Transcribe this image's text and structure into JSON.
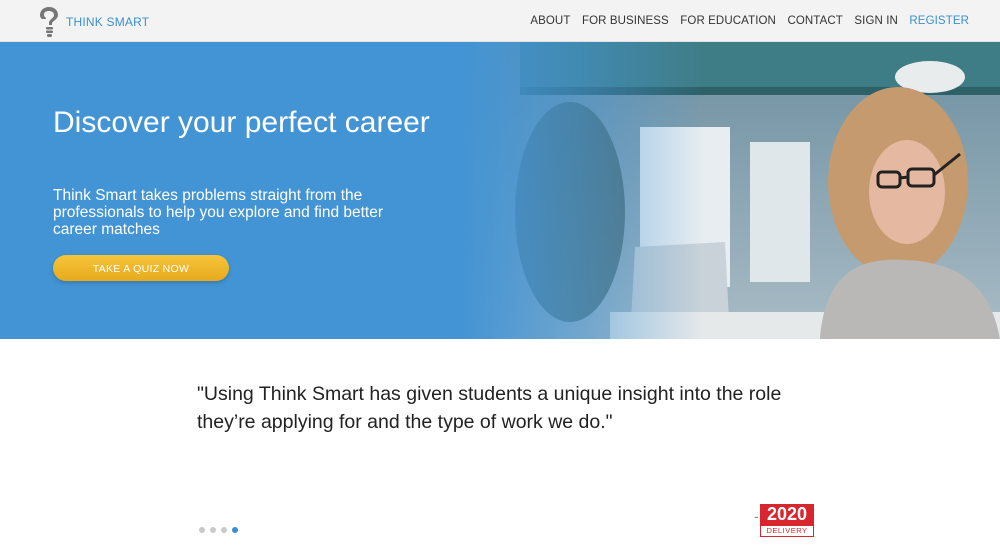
{
  "brand": {
    "name": "THINK SMART",
    "icon": "lightbulb-question-icon"
  },
  "nav": {
    "items": [
      "ABOUT",
      "FOR BUSINESS",
      "FOR EDUCATION",
      "CONTACT",
      "SIGN IN"
    ],
    "register": "REGISTER"
  },
  "hero": {
    "title": "Discover your perfect career",
    "subtitle": "Think Smart takes problems straight from the professionals to help you explore and find better career matches",
    "cta": "TAKE A QUIZ NOW"
  },
  "testimonial": {
    "quote": "\"Using Think Smart has given students a unique insight into the role they’re applying for and the type of work we do.\"",
    "attribution_dash": "-",
    "client_logo": {
      "top": "2020",
      "bottom": "DELIVERY"
    },
    "slides": 4,
    "active_slide": 4
  },
  "colors": {
    "accent": "#3a8fd0",
    "hero_bg": "#4394d4",
    "cta": "#f0b72c",
    "client_red": "#d8262e"
  }
}
